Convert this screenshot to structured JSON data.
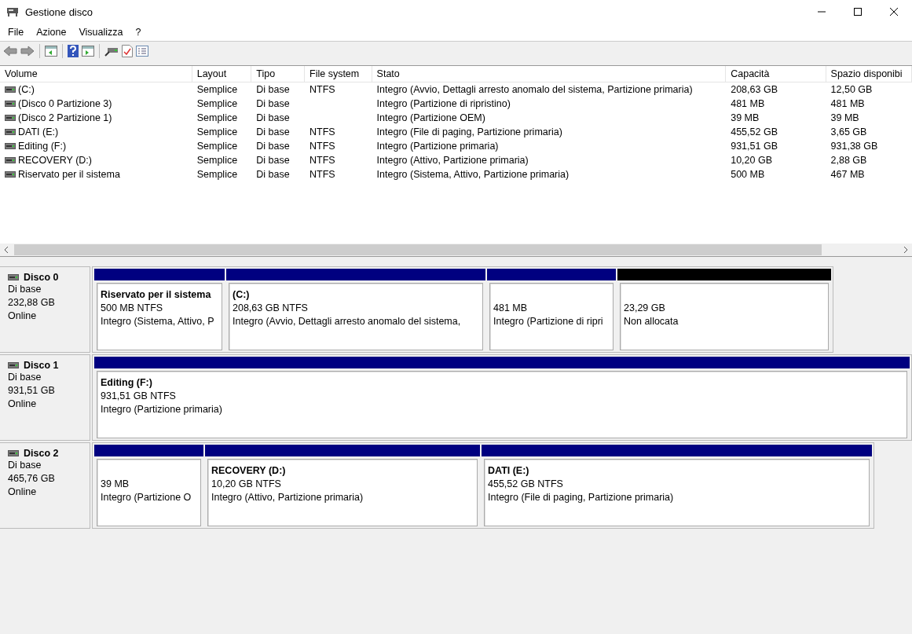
{
  "window": {
    "title": "Gestione disco"
  },
  "menu": [
    "File",
    "Azione",
    "Visualizza",
    "?"
  ],
  "table": {
    "columns": [
      "Volume",
      "Layout",
      "Tipo",
      "File system",
      "Stato",
      "Capacità",
      "Spazio disponibi"
    ],
    "rows": [
      [
        "(C:)",
        "Semplice",
        "Di base",
        "NTFS",
        "Integro (Avvio, Dettagli arresto anomalo del sistema, Partizione primaria)",
        "208,63 GB",
        "12,50 GB"
      ],
      [
        "(Disco 0 Partizione 3)",
        "Semplice",
        "Di base",
        "",
        "Integro (Partizione di ripristino)",
        "481 MB",
        "481 MB"
      ],
      [
        "(Disco 2 Partizione 1)",
        "Semplice",
        "Di base",
        "",
        "Integro (Partizione OEM)",
        "39 MB",
        "39 MB"
      ],
      [
        "DATI (E:)",
        "Semplice",
        "Di base",
        "NTFS",
        "Integro (File di paging, Partizione primaria)",
        "455,52 GB",
        "3,65 GB"
      ],
      [
        "Editing (F:)",
        "Semplice",
        "Di base",
        "NTFS",
        "Integro (Partizione primaria)",
        "931,51 GB",
        "931,38 GB"
      ],
      [
        "RECOVERY (D:)",
        "Semplice",
        "Di base",
        "NTFS",
        "Integro (Attivo, Partizione primaria)",
        "10,20 GB",
        "2,88 GB"
      ],
      [
        "Riservato per il sistema",
        "Semplice",
        "Di base",
        "NTFS",
        "Integro (Sistema, Attivo, Partizione primaria)",
        "500 MB",
        "467 MB"
      ]
    ]
  },
  "disks": [
    {
      "name": "Disco 0",
      "type": "Di base",
      "size": "232,88 GB",
      "status": "Online",
      "partitions": [
        {
          "kind": "primary",
          "name": "Riservato per il sistema",
          "size": "500 MB NTFS",
          "status": "Integro (Sistema, Attivo, P"
        },
        {
          "kind": "primary",
          "name": "(C:)",
          "size": "208,63 GB NTFS",
          "status": "Integro (Avvio, Dettagli arresto anomalo del sistema,"
        },
        {
          "kind": "primary",
          "size": "481 MB",
          "status": "Integro (Partizione di ripri"
        },
        {
          "kind": "unallocated",
          "size": "23,29 GB",
          "status": "Non allocata"
        }
      ]
    },
    {
      "name": "Disco 1",
      "type": "Di base",
      "size": "931,51 GB",
      "status": "Online",
      "partitions": [
        {
          "kind": "primary",
          "name": "Editing  (F:)",
          "size": "931,51 GB NTFS",
          "status": "Integro (Partizione primaria)"
        }
      ]
    },
    {
      "name": "Disco 2",
      "type": "Di base",
      "size": "465,76 GB",
      "status": "Online",
      "partitions": [
        {
          "kind": "primary",
          "size": "39 MB",
          "status": "Integro (Partizione O"
        },
        {
          "kind": "primary",
          "name": "RECOVERY  (D:)",
          "size": "10,20 GB NTFS",
          "status": "Integro (Attivo, Partizione primaria)"
        },
        {
          "kind": "primary",
          "name": "DATI  (E:)",
          "size": "455,52 GB NTFS",
          "status": "Integro (File di paging, Partizione primaria)"
        }
      ]
    }
  ]
}
